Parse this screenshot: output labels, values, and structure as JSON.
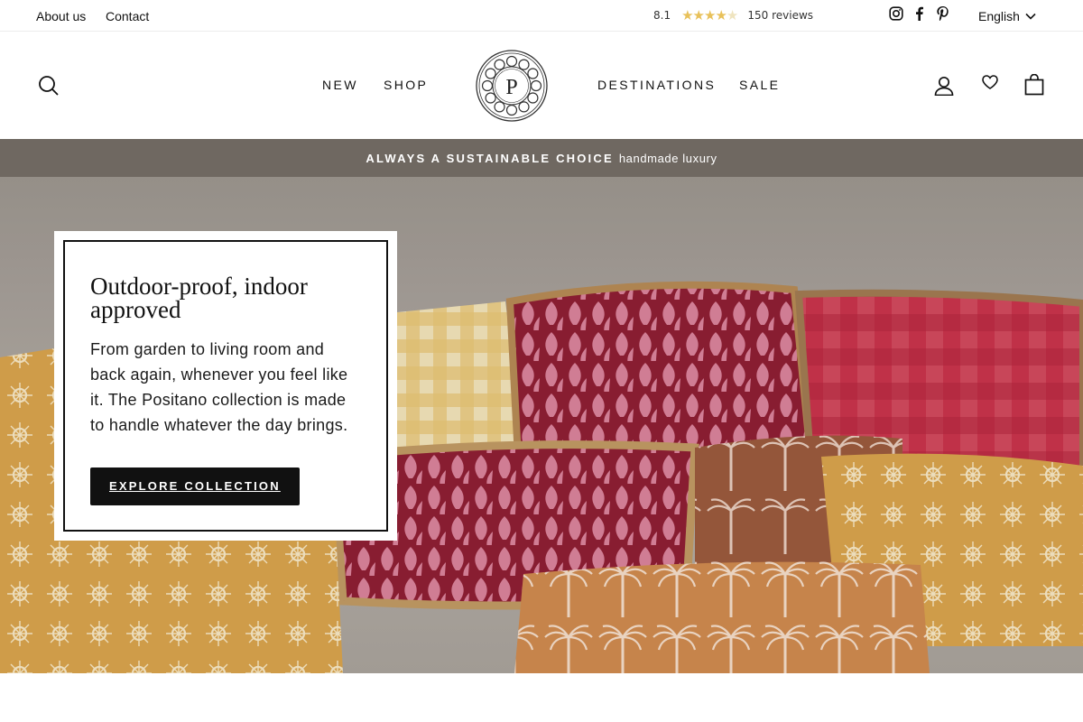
{
  "topbar": {
    "about": "About us",
    "contact": "Contact",
    "rating_score": "8.1",
    "rating_stars": 4.5,
    "rating_max": 5,
    "reviews": "150 reviews",
    "language": "English",
    "social_icons": [
      "instagram-icon",
      "facebook-icon",
      "pinterest-icon"
    ]
  },
  "header": {
    "nav_left": [
      "NEW",
      "SHOP"
    ],
    "nav_right": [
      "DESTINATIONS",
      "SALE"
    ],
    "logo_letter": "P",
    "icons": [
      "search-icon",
      "account-icon",
      "heart-icon",
      "bag-icon"
    ]
  },
  "announcement": {
    "strong": "ALWAYS A SUSTAINABLE CHOICE",
    "light": "handmade luxury",
    "background": "#6f6861"
  },
  "hero": {
    "title": "Outdoor-proof, indoor approved",
    "body": "From garden to living room and back again, whenever you feel like it. The Positano collection is made to handle whatever the day brings.",
    "button": "EXPLORE COLLECTION"
  },
  "colors": {
    "text": "#111111",
    "button_bg": "#111111",
    "star": "#e8c15a"
  }
}
